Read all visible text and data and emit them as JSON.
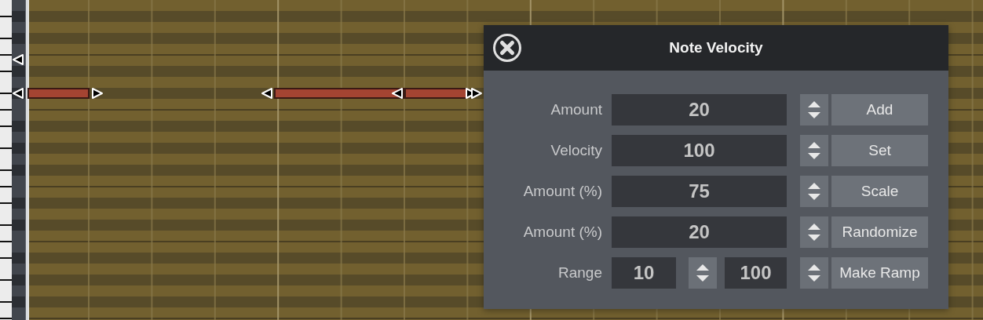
{
  "dialog": {
    "title": "Note Velocity",
    "rows": [
      {
        "kind": "single",
        "label": "Amount",
        "value": "20",
        "button": "Add"
      },
      {
        "kind": "single",
        "label": "Velocity",
        "value": "100",
        "button": "Set"
      },
      {
        "kind": "single",
        "label": "Amount (%)",
        "value": "75",
        "button": "Scale"
      },
      {
        "kind": "single",
        "label": "Amount (%)",
        "value": "20",
        "button": "Randomize"
      },
      {
        "kind": "range",
        "label": "Range",
        "values": [
          "10",
          "100"
        ],
        "button": "Make Ramp"
      }
    ]
  }
}
